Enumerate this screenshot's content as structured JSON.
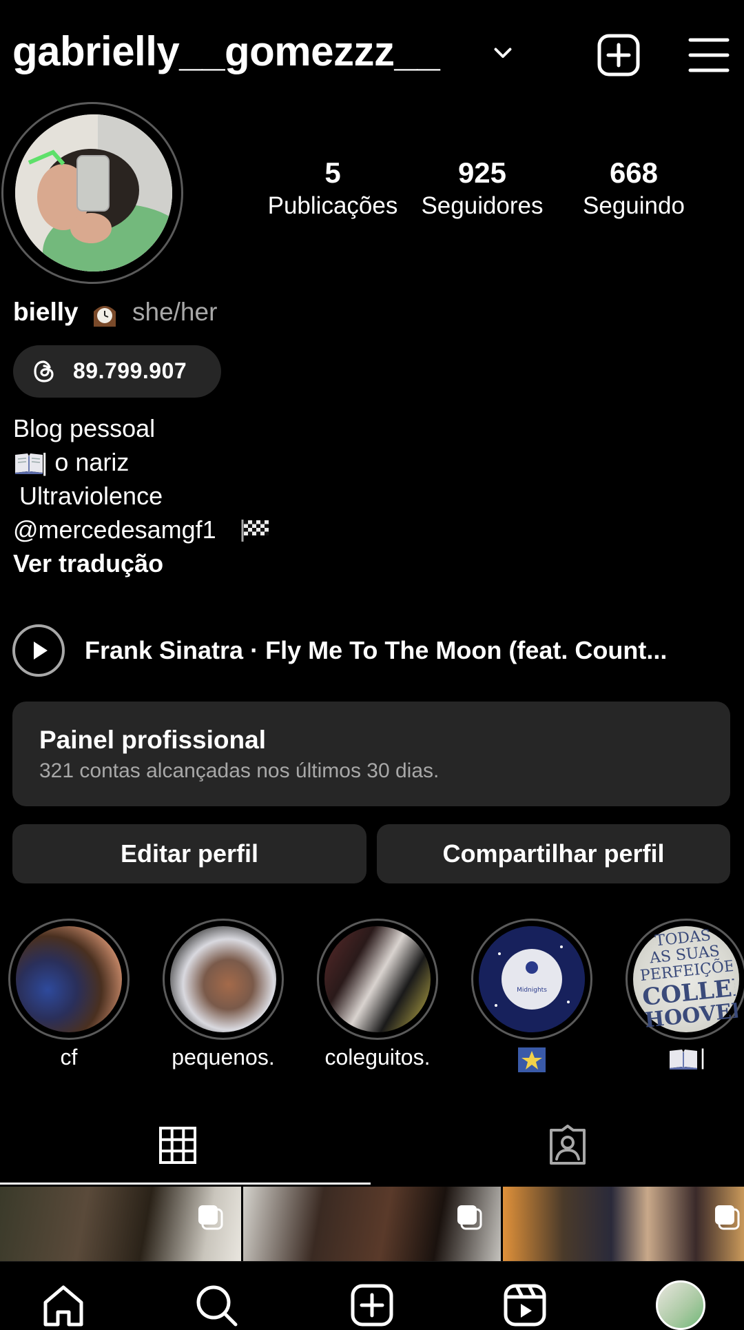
{
  "header": {
    "username": "gabrielly__gomezzz__",
    "username_chevron_icon": "chevron-down-icon",
    "create_icon": "plus-square-icon",
    "menu_icon": "hamburger-menu-icon"
  },
  "stats": {
    "posts": {
      "value": "5",
      "label": "Publicações"
    },
    "followers": {
      "value": "925",
      "label": "Seguidores"
    },
    "following": {
      "value": "668",
      "label": "Seguindo"
    }
  },
  "profile": {
    "display_name": "bielly",
    "name_emoji_icon": "mantelpiece-clock-icon",
    "pronouns": "she/her",
    "threads_icon": "threads-logo-icon",
    "threads_count": "89.799.907",
    "bio_lines": [
      "Blog pessoal",
      "| o nariz",
      "Ultraviolence",
      "@mercedesamgf1"
    ],
    "bio_icons": [
      "open-book-icon",
      "checkered-flag-icon"
    ],
    "see_translation": "Ver tradução"
  },
  "music": {
    "play_icon": "play-icon",
    "title": "Frank Sinatra · Fly Me To The Moon (feat. Count..."
  },
  "professional_dashboard": {
    "title": "Painel profissional",
    "subtitle": "321 contas alcançadas nos últimos 30 dias."
  },
  "actions": {
    "edit_profile": "Editar perfil",
    "share_profile": "Compartilhar perfil"
  },
  "highlights": [
    {
      "label": "cf"
    },
    {
      "label": "pequenos."
    },
    {
      "label": "coleguitos."
    },
    {
      "label": "",
      "icon": "star-emoji-icon"
    },
    {
      "label": "|",
      "icon": "open-book-icon",
      "cover_text": [
        "TODAS",
        "AS SUAS",
        "PERFEIÇÕES",
        "COLLEEN",
        "HOOVER"
      ]
    }
  ],
  "tabs": [
    {
      "name": "grid",
      "icon": "grid-icon",
      "active": true
    },
    {
      "name": "tagged",
      "icon": "tagged-person-icon",
      "active": false
    }
  ],
  "posts": [
    {
      "type": "carousel",
      "icon": "multiple-posts-icon"
    },
    {
      "type": "carousel",
      "icon": "multiple-posts-icon"
    },
    {
      "type": "carousel",
      "icon": "multiple-posts-icon"
    }
  ],
  "bottom_nav": [
    {
      "name": "home",
      "icon": "home-icon"
    },
    {
      "name": "search",
      "icon": "search-icon"
    },
    {
      "name": "create",
      "icon": "plus-square-icon"
    },
    {
      "name": "reels",
      "icon": "reels-icon"
    },
    {
      "name": "profile",
      "icon": "profile-avatar-icon"
    }
  ]
}
